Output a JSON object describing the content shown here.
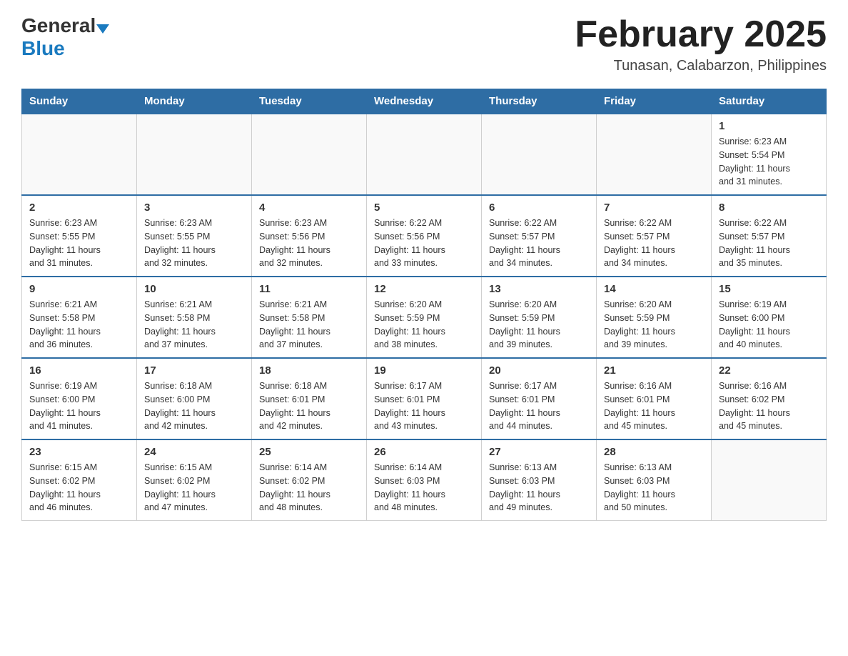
{
  "header": {
    "logo_general": "General",
    "logo_blue": "Blue",
    "month_title": "February 2025",
    "location": "Tunasan, Calabarzon, Philippines"
  },
  "weekdays": [
    "Sunday",
    "Monday",
    "Tuesday",
    "Wednesday",
    "Thursday",
    "Friday",
    "Saturday"
  ],
  "weeks": [
    [
      {
        "day": "",
        "info": ""
      },
      {
        "day": "",
        "info": ""
      },
      {
        "day": "",
        "info": ""
      },
      {
        "day": "",
        "info": ""
      },
      {
        "day": "",
        "info": ""
      },
      {
        "day": "",
        "info": ""
      },
      {
        "day": "1",
        "info": "Sunrise: 6:23 AM\nSunset: 5:54 PM\nDaylight: 11 hours\nand 31 minutes."
      }
    ],
    [
      {
        "day": "2",
        "info": "Sunrise: 6:23 AM\nSunset: 5:55 PM\nDaylight: 11 hours\nand 31 minutes."
      },
      {
        "day": "3",
        "info": "Sunrise: 6:23 AM\nSunset: 5:55 PM\nDaylight: 11 hours\nand 32 minutes."
      },
      {
        "day": "4",
        "info": "Sunrise: 6:23 AM\nSunset: 5:56 PM\nDaylight: 11 hours\nand 32 minutes."
      },
      {
        "day": "5",
        "info": "Sunrise: 6:22 AM\nSunset: 5:56 PM\nDaylight: 11 hours\nand 33 minutes."
      },
      {
        "day": "6",
        "info": "Sunrise: 6:22 AM\nSunset: 5:57 PM\nDaylight: 11 hours\nand 34 minutes."
      },
      {
        "day": "7",
        "info": "Sunrise: 6:22 AM\nSunset: 5:57 PM\nDaylight: 11 hours\nand 34 minutes."
      },
      {
        "day": "8",
        "info": "Sunrise: 6:22 AM\nSunset: 5:57 PM\nDaylight: 11 hours\nand 35 minutes."
      }
    ],
    [
      {
        "day": "9",
        "info": "Sunrise: 6:21 AM\nSunset: 5:58 PM\nDaylight: 11 hours\nand 36 minutes."
      },
      {
        "day": "10",
        "info": "Sunrise: 6:21 AM\nSunset: 5:58 PM\nDaylight: 11 hours\nand 37 minutes."
      },
      {
        "day": "11",
        "info": "Sunrise: 6:21 AM\nSunset: 5:58 PM\nDaylight: 11 hours\nand 37 minutes."
      },
      {
        "day": "12",
        "info": "Sunrise: 6:20 AM\nSunset: 5:59 PM\nDaylight: 11 hours\nand 38 minutes."
      },
      {
        "day": "13",
        "info": "Sunrise: 6:20 AM\nSunset: 5:59 PM\nDaylight: 11 hours\nand 39 minutes."
      },
      {
        "day": "14",
        "info": "Sunrise: 6:20 AM\nSunset: 5:59 PM\nDaylight: 11 hours\nand 39 minutes."
      },
      {
        "day": "15",
        "info": "Sunrise: 6:19 AM\nSunset: 6:00 PM\nDaylight: 11 hours\nand 40 minutes."
      }
    ],
    [
      {
        "day": "16",
        "info": "Sunrise: 6:19 AM\nSunset: 6:00 PM\nDaylight: 11 hours\nand 41 minutes."
      },
      {
        "day": "17",
        "info": "Sunrise: 6:18 AM\nSunset: 6:00 PM\nDaylight: 11 hours\nand 42 minutes."
      },
      {
        "day": "18",
        "info": "Sunrise: 6:18 AM\nSunset: 6:01 PM\nDaylight: 11 hours\nand 42 minutes."
      },
      {
        "day": "19",
        "info": "Sunrise: 6:17 AM\nSunset: 6:01 PM\nDaylight: 11 hours\nand 43 minutes."
      },
      {
        "day": "20",
        "info": "Sunrise: 6:17 AM\nSunset: 6:01 PM\nDaylight: 11 hours\nand 44 minutes."
      },
      {
        "day": "21",
        "info": "Sunrise: 6:16 AM\nSunset: 6:01 PM\nDaylight: 11 hours\nand 45 minutes."
      },
      {
        "day": "22",
        "info": "Sunrise: 6:16 AM\nSunset: 6:02 PM\nDaylight: 11 hours\nand 45 minutes."
      }
    ],
    [
      {
        "day": "23",
        "info": "Sunrise: 6:15 AM\nSunset: 6:02 PM\nDaylight: 11 hours\nand 46 minutes."
      },
      {
        "day": "24",
        "info": "Sunrise: 6:15 AM\nSunset: 6:02 PM\nDaylight: 11 hours\nand 47 minutes."
      },
      {
        "day": "25",
        "info": "Sunrise: 6:14 AM\nSunset: 6:02 PM\nDaylight: 11 hours\nand 48 minutes."
      },
      {
        "day": "26",
        "info": "Sunrise: 6:14 AM\nSunset: 6:03 PM\nDaylight: 11 hours\nand 48 minutes."
      },
      {
        "day": "27",
        "info": "Sunrise: 6:13 AM\nSunset: 6:03 PM\nDaylight: 11 hours\nand 49 minutes."
      },
      {
        "day": "28",
        "info": "Sunrise: 6:13 AM\nSunset: 6:03 PM\nDaylight: 11 hours\nand 50 minutes."
      },
      {
        "day": "",
        "info": ""
      }
    ]
  ]
}
